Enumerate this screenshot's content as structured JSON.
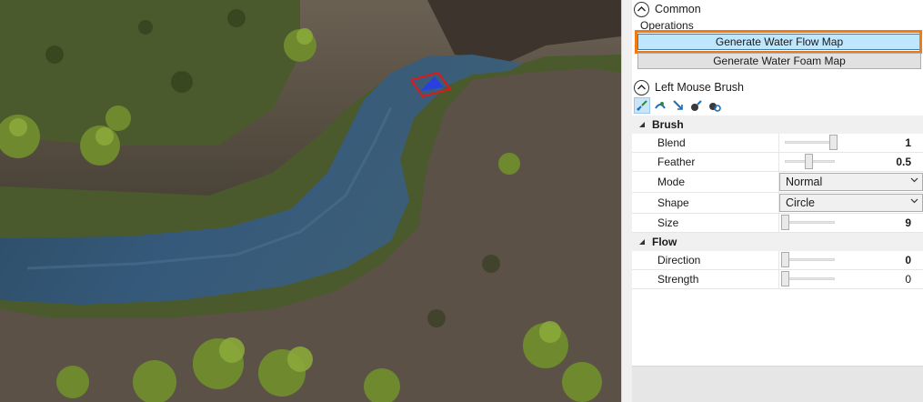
{
  "sections": {
    "common": {
      "title": "Common",
      "operations_label": "Operations",
      "buttons": {
        "flow": "Generate Water Flow Map",
        "foam": "Generate Water Foam Map"
      }
    },
    "brush": {
      "title": "Left Mouse Brush",
      "tools": [
        "brush-tool-icon",
        "smooth-tool-icon",
        "flow-arrow-tool-icon",
        "foam-paint-tool-icon",
        "foam-erase-tool-icon"
      ]
    }
  },
  "grid": {
    "brush_category": "Brush",
    "flow_category": "Flow",
    "blend": {
      "label": "Blend",
      "value": "1",
      "level": 1.0
    },
    "feather": {
      "label": "Feather",
      "value": "0.5",
      "level": 0.5
    },
    "mode": {
      "label": "Mode",
      "value": "Normal"
    },
    "shape": {
      "label": "Shape",
      "value": "Circle"
    },
    "size": {
      "label": "Size",
      "value": "9",
      "level": 0.0
    },
    "direction": {
      "label": "Direction",
      "value": "0",
      "level": 0.0
    },
    "strength": {
      "label": "Strength",
      "value": "0",
      "level": 0.0
    }
  },
  "colors": {
    "highlight": "#f07a13",
    "active_button": "#bee6fd",
    "water": "#2f5570",
    "terrain": "#5a4f45",
    "foliage": "#6b7d2f"
  }
}
